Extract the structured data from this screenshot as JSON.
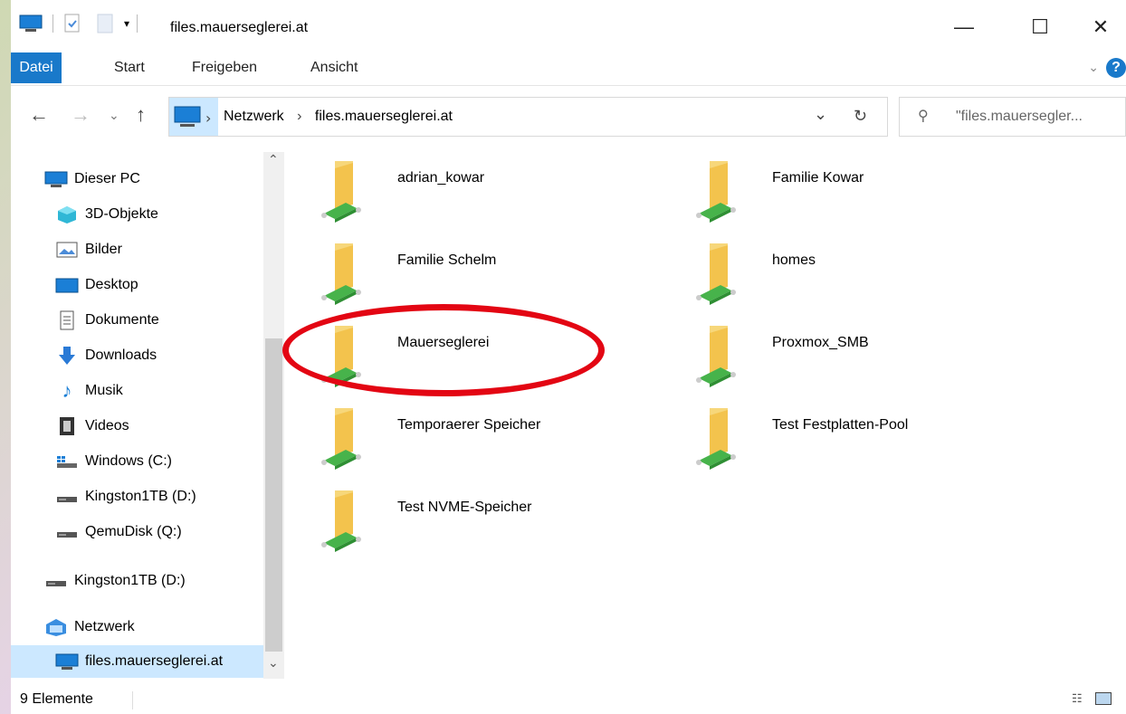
{
  "window": {
    "title": "files.mauerseglerei.at"
  },
  "ribbon": {
    "tabs": [
      {
        "label": "Datei"
      },
      {
        "label": "Start"
      },
      {
        "label": "Freigeben"
      },
      {
        "label": "Ansicht"
      }
    ]
  },
  "address": {
    "segments": [
      "Netzwerk",
      "files.mauerseglerei.at"
    ]
  },
  "search": {
    "placeholder": "\"files.mauersegler..."
  },
  "sidebar": {
    "items": [
      {
        "label": "Dieser PC",
        "icon": "pc-icon"
      },
      {
        "label": "3D-Objekte",
        "icon": "3d-objects-icon"
      },
      {
        "label": "Bilder",
        "icon": "pictures-icon"
      },
      {
        "label": "Desktop",
        "icon": "desktop-icon"
      },
      {
        "label": "Dokumente",
        "icon": "documents-icon"
      },
      {
        "label": "Downloads",
        "icon": "downloads-icon"
      },
      {
        "label": "Musik",
        "icon": "music-icon"
      },
      {
        "label": "Videos",
        "icon": "videos-icon"
      },
      {
        "label": "Windows (C:)",
        "icon": "windows-drive-icon"
      },
      {
        "label": "Kingston1TB (D:)",
        "icon": "drive-icon"
      },
      {
        "label": "QemuDisk (Q:)",
        "icon": "drive-icon"
      },
      {
        "label": "Kingston1TB (D:)",
        "icon": "drive-icon"
      },
      {
        "label": "Netzwerk",
        "icon": "network-icon"
      },
      {
        "label": "files.mauerseglerei.at",
        "icon": "computer-icon",
        "selected": true
      }
    ]
  },
  "shares": [
    {
      "name": "adrian_kowar"
    },
    {
      "name": "Familie Kowar"
    },
    {
      "name": "Familie Schelm"
    },
    {
      "name": "homes"
    },
    {
      "name": "Mauerseglerei"
    },
    {
      "name": "Proxmox_SMB"
    },
    {
      "name": "Temporaerer Speicher"
    },
    {
      "name": "Test Festplatten-Pool"
    },
    {
      "name": "Test NVME-Speicher"
    }
  ],
  "status": {
    "count": "9 Elemente"
  },
  "colors": {
    "accent": "#1979ca",
    "selection": "#cce8ff",
    "highlight_ellipse": "#e30613"
  }
}
